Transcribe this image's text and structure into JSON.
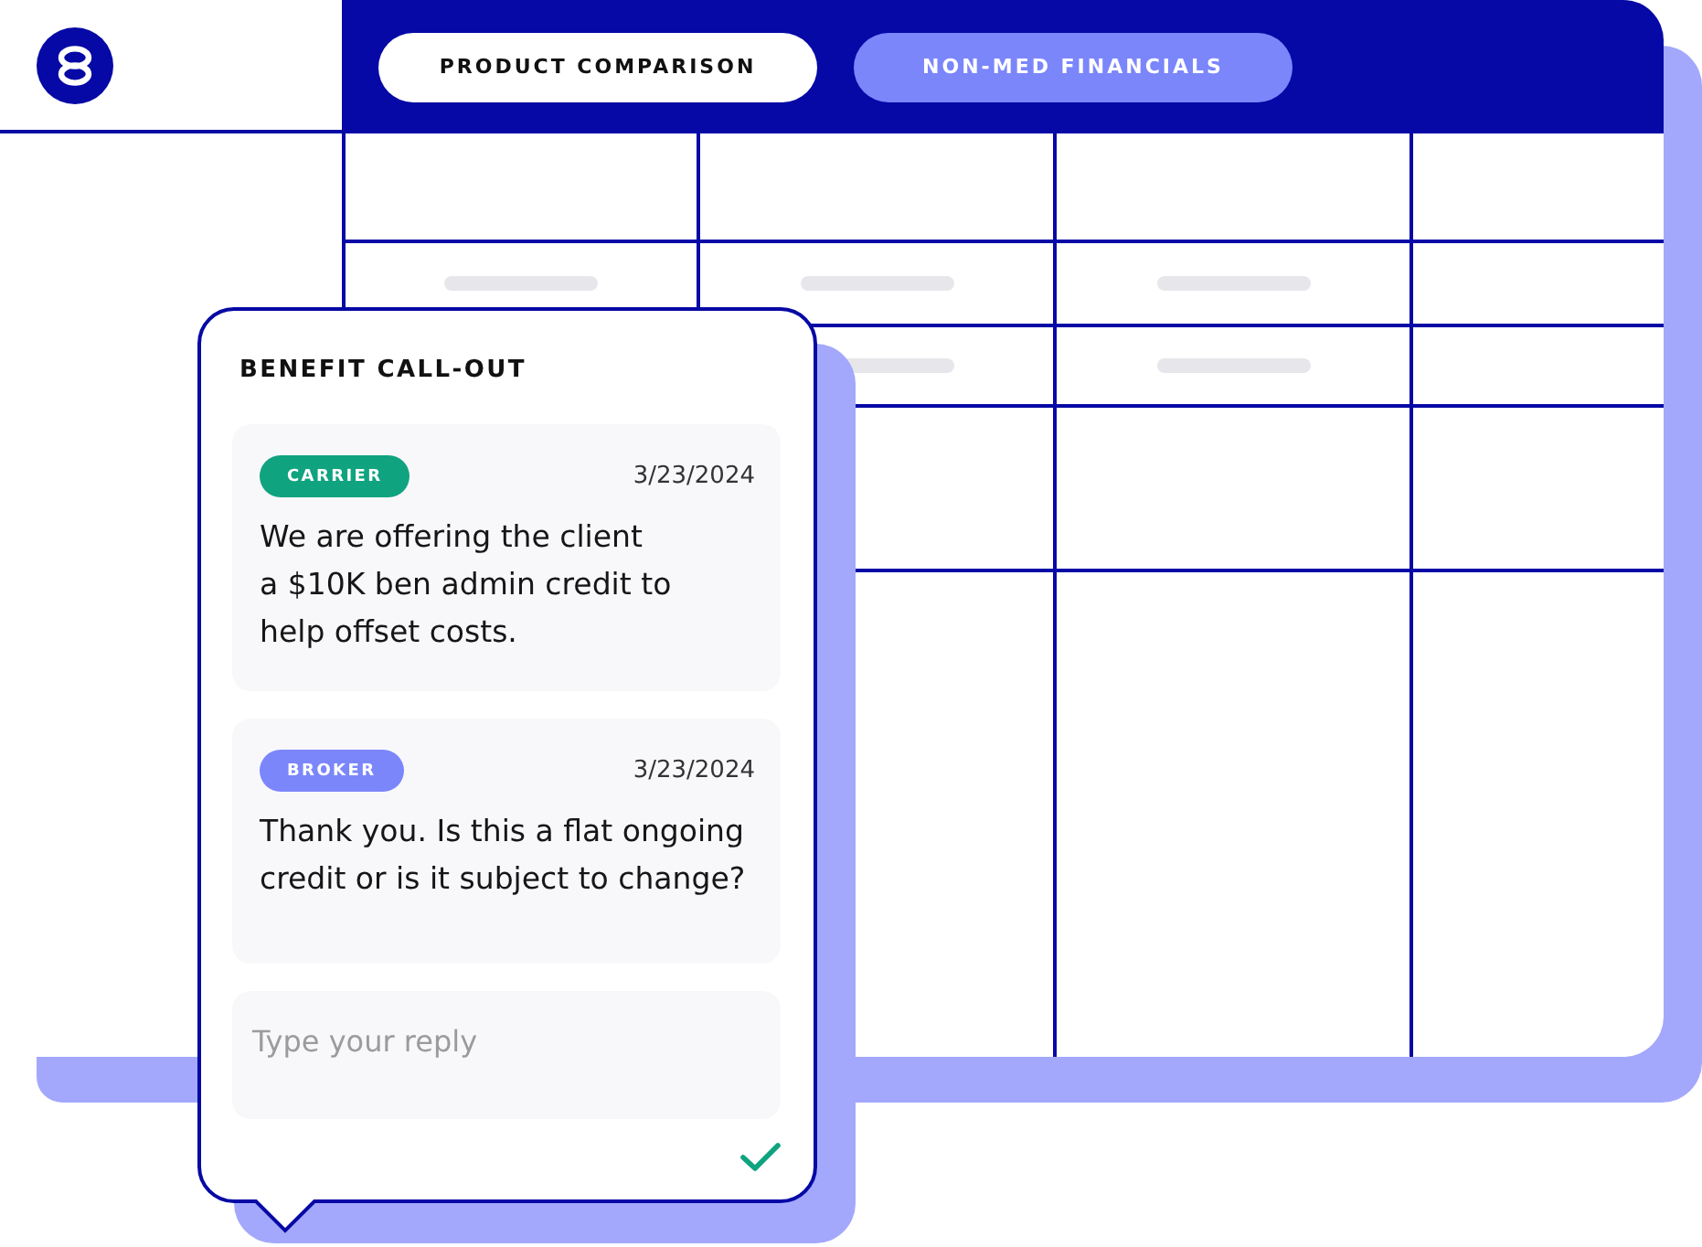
{
  "tabs": [
    {
      "label": "PRODUCT COMPARISON",
      "selected": true
    },
    {
      "label": "NON-MED FINANCIALS",
      "selected": false
    }
  ],
  "table": {
    "rows": [
      {
        "cells": [
          {
            "kind": "blank"
          },
          {
            "kind": "blank"
          },
          {
            "kind": "blank"
          },
          {
            "kind": "blank"
          }
        ]
      },
      {
        "cells": [
          {
            "kind": "skeleton"
          },
          {
            "kind": "skeleton"
          },
          {
            "kind": "skeleton"
          },
          {
            "kind": "blank"
          }
        ]
      },
      {
        "cells": [
          {
            "kind": "covered"
          },
          {
            "kind": "skeleton"
          },
          {
            "kind": "skeleton"
          },
          {
            "kind": "blank"
          }
        ]
      },
      {
        "cells": [
          {
            "kind": "covered"
          },
          {
            "kind": "blank"
          },
          {
            "kind": "blank"
          },
          {
            "kind": "blank"
          }
        ]
      },
      {
        "cells": [
          {
            "kind": "covered"
          },
          {
            "kind": "blank"
          },
          {
            "kind": "blank"
          },
          {
            "kind": "blank"
          }
        ]
      }
    ]
  },
  "callout": {
    "title": "BENEFIT CALL-OUT",
    "messages": [
      {
        "author": "CARRIER",
        "color": "#10a37f",
        "date": "3/23/2024",
        "text": "We are offering the client\na $10K ben admin credit to\nhelp offset costs."
      },
      {
        "author": "BROKER",
        "color": "#7b86fb",
        "date": "3/23/2024",
        "text": "Thank you. Is this a flat ongoing\ncredit or is it subject to change?"
      }
    ],
    "reply": {
      "placeholder": "Type your reply"
    }
  }
}
